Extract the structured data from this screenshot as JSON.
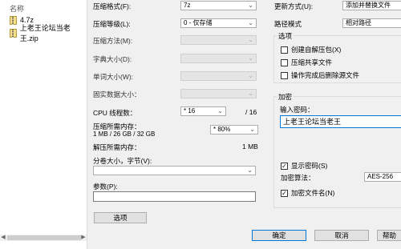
{
  "files": {
    "header": "名称",
    "items": [
      {
        "name": "4.7z",
        "icon": "archive-file-icon"
      },
      {
        "name": "上老王论坛当老王.zip",
        "icon": "archive-file-icon"
      }
    ]
  },
  "form": {
    "format_label": "压缩格式(F):",
    "format_value": "7z",
    "level_label": "压缩等级(L):",
    "level_value": "0 - 仅存储",
    "method_label": "压缩方法(M):",
    "dict_label": "字典大小(D):",
    "word_label": "单词大小(W):",
    "solid_label": "固实数据大小：",
    "cpu_label": "CPU 线程数：",
    "cpu_value": "* 16",
    "cpu_total": "/ 16",
    "mem_compress_label": "压缩所需内存：",
    "mem_compress_detail": "1 MB / 26 GB / 32 GB",
    "mem_percent": "* 80%",
    "mem_decompress_label": "解压所需内存：",
    "mem_decompress_value": "1 MB",
    "split_label": "分卷大小，字节(V):",
    "params_label": "参数(P):",
    "options_button": "选项"
  },
  "right": {
    "update_label": "更新方式(U):",
    "update_value": "添加并替换文件",
    "path_label": "路径模式",
    "path_value": "相对路径",
    "options_group": "选项",
    "opt_sfx": "创建自解压包(X)",
    "opt_shared": "压缩共享文件",
    "opt_delete": "操作完成后删除源文件",
    "encrypt_group": "加密",
    "password_label": "输入密码：",
    "password_value": "上老王论坛当老王",
    "show_password": "显示密码(S)",
    "algo_label": "加密算法：",
    "algo_value": "AES-256",
    "encrypt_names": "加密文件名(N)"
  },
  "buttons": {
    "ok": "确定",
    "cancel": "取消",
    "help": "帮助"
  }
}
